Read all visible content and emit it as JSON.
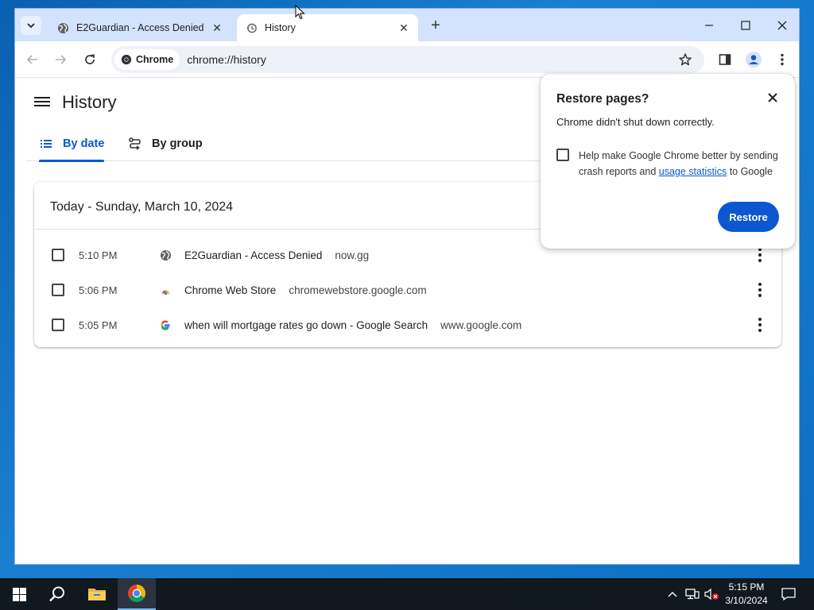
{
  "browser": {
    "tabs": [
      {
        "title": "E2Guardian - Access Denied",
        "icon": "globe-icon",
        "active": false
      },
      {
        "title": "History",
        "icon": "history-icon",
        "active": true
      }
    ],
    "omnibox": {
      "chip_label": "Chrome",
      "url": "chrome://history"
    }
  },
  "history": {
    "page_title": "History",
    "tabs": [
      {
        "label": "By date",
        "selected": true
      },
      {
        "label": "By group",
        "selected": false
      }
    ],
    "date_heading": "Today - Sunday, March 10, 2024",
    "items": [
      {
        "time": "5:10 PM",
        "title": "E2Guardian - Access Denied",
        "domain": "now.gg",
        "icon": "globe-icon"
      },
      {
        "time": "5:06 PM",
        "title": "Chrome Web Store",
        "domain": "chromewebstore.google.com",
        "icon": "webstore-icon"
      },
      {
        "time": "5:05 PM",
        "title": "when will mortgage rates go down - Google Search",
        "domain": "www.google.com",
        "icon": "google-icon"
      }
    ]
  },
  "restore_popup": {
    "title": "Restore pages?",
    "message": "Chrome didn't shut down correctly.",
    "checkbox_text_before": "Help make Google Chrome better by sending crash reports and ",
    "checkbox_link": "usage statistics",
    "checkbox_text_after": " to Google",
    "checked": false,
    "restore_label": "Restore"
  },
  "taskbar": {
    "time": "5:15 PM",
    "date": "3/10/2024"
  },
  "colors": {
    "accent": "#0b57d0",
    "tabstrip": "#d3e3fd",
    "taskbar": "#101820"
  }
}
